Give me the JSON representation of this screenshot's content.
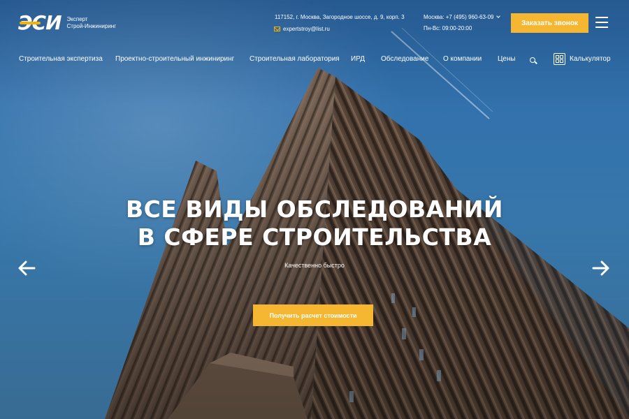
{
  "header": {
    "logo": {
      "mark": "ЭСИ",
      "subtitle_line1": "Эксперт",
      "subtitle_line2": "Строй-Инжиниринг"
    },
    "address": "117152, г. Москва, Загородное шоссе, д. 9, корп. 3",
    "email": "expertstroy@list.ru",
    "phone": "Москва: +7 (495) 960-63-09",
    "hours": "Пн-Вс: 09:00-20:00",
    "call_button": "Заказать звонок",
    "menu_icon": "hamburger-icon"
  },
  "nav": {
    "items": [
      "Строительная экспертиза",
      "Проектно-строительный инжиниринг",
      "Строительная лаборатория",
      "ИРД",
      "Обследование",
      "О компании",
      "Цены"
    ],
    "search_icon": "search-icon",
    "calculator_label": "Калькулятор",
    "calculator_icon": "calculator-icon"
  },
  "hero": {
    "title_line1": "ВСЕ ВИДЫ ОБСЛЕДОВАНИЙ",
    "title_line2": "В СФЕРЕ СТРОИТЕЛЬСТВА",
    "subtitle": "Качественно быстро",
    "cta_button": "Получить расчет стоимости",
    "prev_icon": "arrow-left-icon",
    "next_icon": "arrow-right-icon"
  },
  "colors": {
    "accent": "#f5b731",
    "sky": "#2e6ca4"
  }
}
